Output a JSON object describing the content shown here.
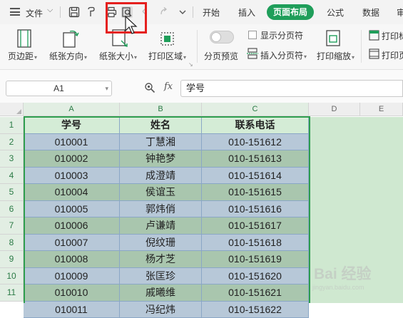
{
  "menubar": {
    "file_label": "文件",
    "tabs": [
      {
        "label": "开始"
      },
      {
        "label": "插入"
      },
      {
        "label": "页面布局",
        "active": true
      },
      {
        "label": "公式"
      },
      {
        "label": "数据"
      },
      {
        "label": "审"
      }
    ]
  },
  "ribbon": {
    "margins": "页边距",
    "orientation": "纸张方向",
    "paper_size": "纸张大小",
    "print_area": "打印区域",
    "page_break_preview": "分页预览",
    "show_page_breaks": "显示分页符",
    "insert_page_break": "插入分页符",
    "print_scale": "打印缩放",
    "print_titles": "打印标",
    "print_titles2": "打印页"
  },
  "formula_bar": {
    "name_box": "A1",
    "fx_label": "fx",
    "formula_value": "学号"
  },
  "sheet": {
    "columns": [
      "A",
      "B",
      "C",
      "D",
      "E"
    ],
    "row_numbers": [
      "1",
      "2",
      "3",
      "4",
      "5",
      "6",
      "7",
      "8",
      "9",
      "10",
      "11"
    ],
    "header": [
      "学号",
      "姓名",
      "联系电话"
    ],
    "rows": [
      [
        "010001",
        "丁慧湘",
        "010-151612"
      ],
      [
        "010002",
        "钟艳梦",
        "010-151613"
      ],
      [
        "010003",
        "成澄靖",
        "010-151614"
      ],
      [
        "010004",
        "侯谊玉",
        "010-151615"
      ],
      [
        "010005",
        "郭炜俏",
        "010-151616"
      ],
      [
        "010006",
        "卢谦靖",
        "010-151617"
      ],
      [
        "010007",
        "倪纹珊",
        "010-151618"
      ],
      [
        "010008",
        "杨才芝",
        "010-151619"
      ],
      [
        "010009",
        "张匡珍",
        "010-151620"
      ],
      [
        "010010",
        "戚曦维",
        "010-151621"
      ],
      [
        "010011",
        "冯纪炜",
        "010-151622"
      ]
    ]
  },
  "colors": {
    "accent": "#1f9e5a",
    "highlight_box": "#e5201e",
    "header_fill": "#d4ecd6",
    "row_fill_odd": "#b7c8d8",
    "row_fill_even": "#a9c6ae",
    "selection_border": "#2e9e4e",
    "sheet_bg_fill": "#cfe8d0"
  },
  "watermark": {
    "text": "Bai 经验",
    "sub": "jingyan.baidu.com"
  }
}
